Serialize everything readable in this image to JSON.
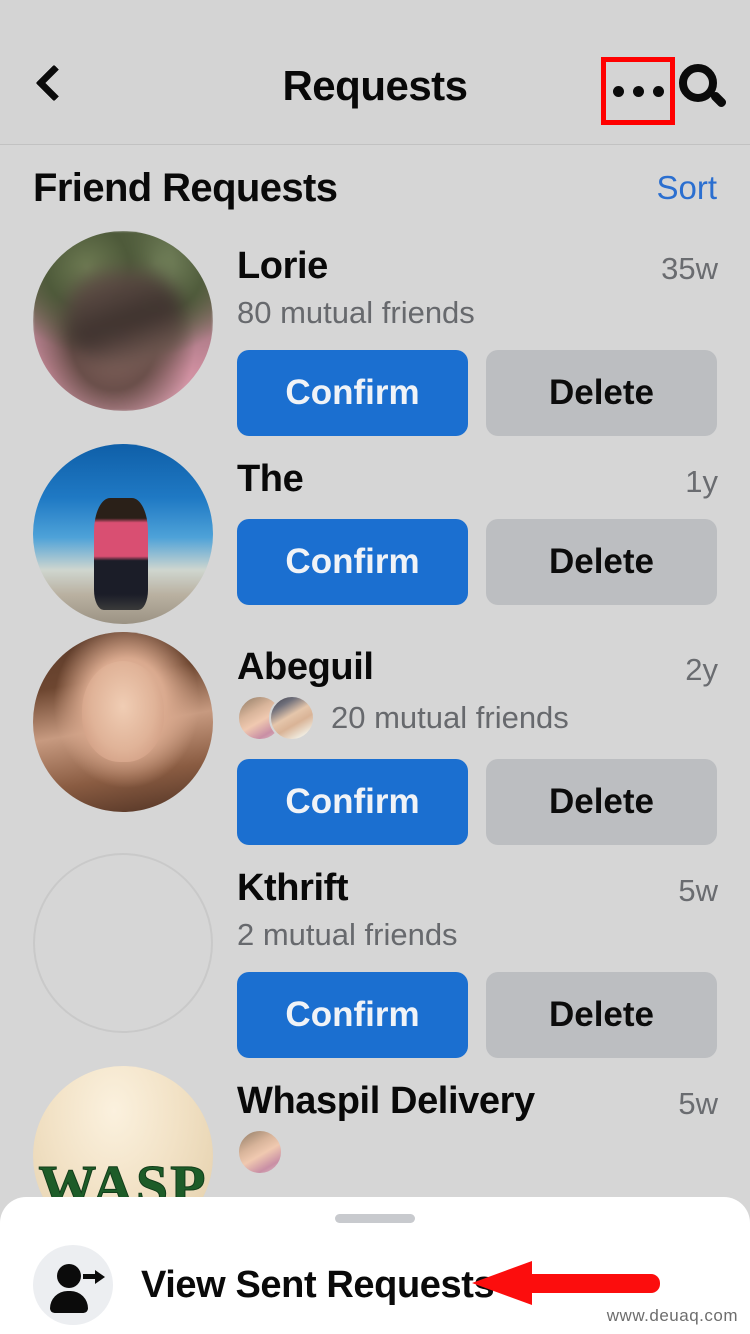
{
  "topbar": {
    "back_icon": "chevron-left-icon",
    "title": "Requests",
    "more_icon": "ellipsis-icon",
    "search_icon": "search-icon"
  },
  "section": {
    "title": "Friend Requests",
    "sort_label": "Sort"
  },
  "buttons": {
    "confirm_label": "Confirm",
    "delete_label": "Delete"
  },
  "requests": [
    {
      "name": "Lorie",
      "time": "35w",
      "mutual": "80 mutual friends",
      "has_mutual_avatars": false,
      "avatar_style": "photo-blurred-outdoor"
    },
    {
      "name": "The",
      "time": "1y",
      "mutual": "",
      "has_mutual_avatars": false,
      "avatar_style": "photo-beach"
    },
    {
      "name": "Abeguil",
      "time": "2y",
      "mutual": "20 mutual friends",
      "has_mutual_avatars": true,
      "avatar_style": "photo-portrait"
    },
    {
      "name": "Kthrift",
      "time": "5w",
      "mutual": "2 mutual friends",
      "has_mutual_avatars": false,
      "avatar_style": "empty-placeholder"
    },
    {
      "name": "Whaspil Delivery",
      "time": "5w",
      "mutual": "",
      "has_mutual_avatars": false,
      "avatar_style": "logo-wasp",
      "avatar_text": "WASP"
    }
  ],
  "sheet": {
    "item_icon": "person-arrow-right-icon",
    "item_label": "View Sent Requests"
  },
  "watermark": "www.deuaq.com",
  "colors": {
    "page_bg": "#d6d6d6",
    "topbar_bg": "#d4d4d4",
    "confirm_blue": "#1b6fd0",
    "delete_grey": "#bcbec1",
    "sort_blue": "#2b6fd0",
    "annotation_red": "#fc0d0d",
    "sheet_bg": "#ffffff"
  }
}
